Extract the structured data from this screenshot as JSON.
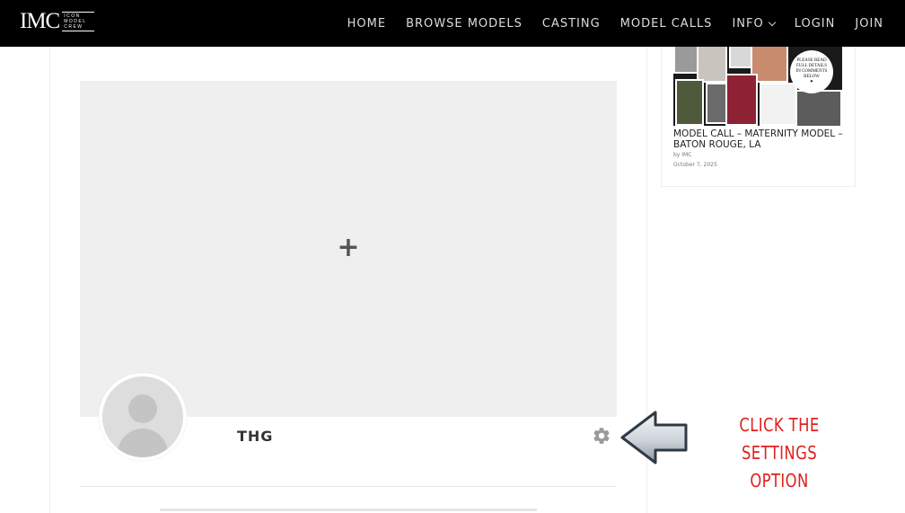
{
  "header": {
    "logo_text": "IMC",
    "logo_sub": [
      "ICON",
      "MODEL",
      "CREW"
    ],
    "nav": [
      {
        "label": "HOME"
      },
      {
        "label": "BROWSE MODELS"
      },
      {
        "label": "CASTING"
      },
      {
        "label": "MODEL CALLS"
      },
      {
        "label": "INFO",
        "has_dropdown": true
      },
      {
        "label": "LOGIN"
      },
      {
        "label": "JOIN"
      }
    ]
  },
  "profile": {
    "cover_add_icon": "+",
    "username": "THG",
    "settings_icon": "gear-icon"
  },
  "sidebar": {
    "post": {
      "image_badge": [
        "PLEASE READ",
        "FULL DETAILS",
        "IN COMMENTS",
        "BELOW",
        "♥"
      ],
      "title": "MODEL CALL – MATERNITY MODEL – BATON ROUGE, LA",
      "author": "by IMC",
      "date": "October 7, 2025"
    }
  },
  "annotation": {
    "line1": "CLICK THE SETTINGS",
    "line2": "OPTION",
    "color": "#e0211b"
  }
}
